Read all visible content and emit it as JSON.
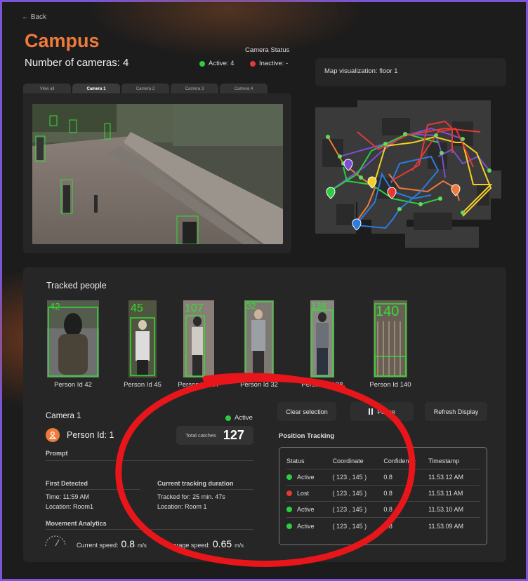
{
  "header": {
    "back_label": "← Back",
    "title": "Campus",
    "camera_count_label": "Number of cameras: 4",
    "camera_status_label": "Camera Status",
    "active_label": "Active: 4",
    "inactive_label": "Inactive: -"
  },
  "tabs": [
    {
      "label": "View all"
    },
    {
      "label": "Camera 1"
    },
    {
      "label": "Camera 2"
    },
    {
      "label": "Camera 3"
    },
    {
      "label": "Camera 4"
    }
  ],
  "map": {
    "title": "Map visualization: floor 1"
  },
  "tracked": {
    "heading": "Tracked people",
    "people": [
      {
        "label": "Person Id 42",
        "tag": "42"
      },
      {
        "label": "Person Id 45",
        "tag": "45"
      },
      {
        "label": "Person Id 107",
        "tag": "107"
      },
      {
        "label": "Person Id 32",
        "tag": "32"
      },
      {
        "label": "Person Id 138",
        "tag": "138"
      },
      {
        "label": "Person Id 140",
        "tag": "140"
      }
    ]
  },
  "detail": {
    "camera": "Camera 1",
    "status": "Active",
    "person": "Person Id: 1",
    "total_catches_label": "Total catches",
    "total_catches": "127",
    "prompt_label": "Prompt",
    "first_detected_label": "First Detected",
    "time": "Time:  11:59 AM",
    "location": "Location:  Room1",
    "duration_label": "Current tracking duration",
    "tracked_for": "Tracked for: 25 min. 47s",
    "location2": "Location:  Room 1",
    "movement_label": "Movement Analytics",
    "current_speed_label": "Current speed:",
    "current_speed": "0.8",
    "unit": "m/s",
    "average_speed_label": "Average speed:",
    "average_speed": "0.65"
  },
  "buttons": {
    "clear": "Clear selection",
    "pause": "Pause",
    "refresh": "Refresh Display"
  },
  "position": {
    "heading": "Position Tracking",
    "columns": [
      "Status",
      "Coordinate",
      "Confidence",
      "Timestamp"
    ],
    "rows": [
      {
        "status": "Active",
        "color": "#2ecc40",
        "coord": "( 123 , 145 )",
        "conf": "0.8",
        "time": "11.53.12 AM"
      },
      {
        "status": "Lost",
        "color": "#e53935",
        "coord": "( 123 , 145 )",
        "conf": "0.8",
        "time": "11.53.11 AM"
      },
      {
        "status": "Active",
        "color": "#2ecc40",
        "coord": "( 123 , 145 )",
        "conf": "0.8",
        "time": "11.53.10 AM"
      },
      {
        "status": "Active",
        "color": "#2ecc40",
        "coord": "( 123 , 145 )",
        "conf": "0.8",
        "time": "11.53.09 AM"
      }
    ]
  },
  "colors": {
    "accent": "#f07a3a",
    "active": "#2ecc40",
    "inactive": "#e53935",
    "annotation": "#e8161a"
  }
}
